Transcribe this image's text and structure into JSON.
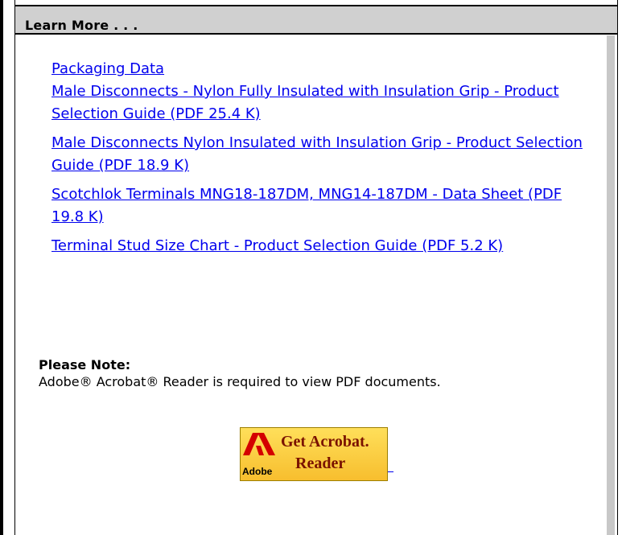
{
  "header": {
    "title": "Learn More . . ."
  },
  "links": [
    {
      "label": "Packaging Data"
    },
    {
      "label": "Male Disconnects - Nylon Fully Insulated with Insulation Grip - Product Selection Guide (PDF 25.4 K)"
    },
    {
      "label": "Male Disconnects Nylon Insulated with Insulation Grip - Product Selection Guide (PDF 18.9 K)"
    },
    {
      "label": "Scotchlok Terminals MNG18-187DM, MNG14-187DM - Data Sheet (PDF 19.8 K)"
    },
    {
      "label": "Terminal Stud Size Chart - Product Selection Guide (PDF 5.2 K)"
    }
  ],
  "note": {
    "title": "Please Note:",
    "text": "Adobe® Acrobat® Reader is required to view PDF documents."
  },
  "acrobat_badge": {
    "line1": "Get Acrobat.",
    "line2": "Reader",
    "brand": "Adobe"
  },
  "colors": {
    "link": "#0000ee",
    "header_bg": "#d0d0d0",
    "badge_bg": "#f7be2e",
    "badge_text": "#7a1200"
  }
}
